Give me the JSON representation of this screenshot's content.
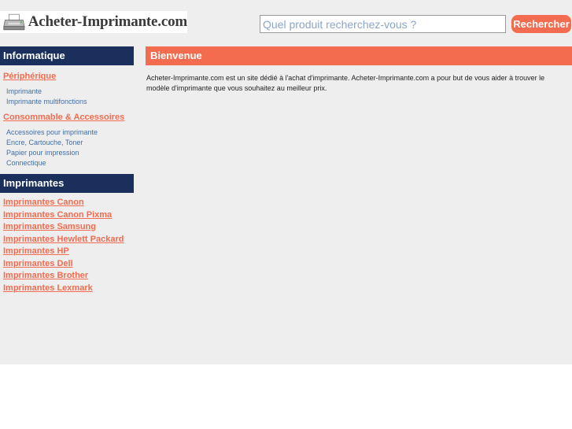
{
  "header": {
    "logo_text": "Acheter-Imprimante.com",
    "search": {
      "placeholder": "Quel produit recherchez-vous ?",
      "button_label": "Rechercher"
    }
  },
  "sidebar": {
    "informatique": {
      "title": "Informatique",
      "categories": [
        {
          "label": "Périphérique",
          "items": [
            "Imprimante",
            "Imprimante multifonctions"
          ]
        },
        {
          "label": "Consommable & Accessoires",
          "items": [
            "Accessoires pour imprimante",
            "Encre, Cartouche, Toner",
            "Papier pour impression",
            "Connectique"
          ]
        }
      ]
    },
    "imprimantes": {
      "title": "Imprimantes",
      "links": [
        "Imprimantes Canon",
        "Imprimantes Canon Pixma",
        "Imprimantes Samsung",
        "Imprimantes Hewlett Packard",
        "Imprimantes HP",
        "Imprimantes Dell",
        "Imprimantes Brother",
        "Imprimantes Lexmark"
      ]
    }
  },
  "main": {
    "title": "Bienvenue",
    "text": "Acheter-Imprimante.com est un site dédié à l'achat d'imprimante. Acheter-Imprimante.com a pour but de vous aider à trouver le modèle d'imprimante que vous souhaitez au meilleur prix."
  },
  "colors": {
    "accent": "#f36c4f",
    "navy": "#1a2f5c",
    "sublink": "#3f6ea8",
    "panel": "#eeeeee"
  },
  "icons": {
    "logo": "printer-icon"
  }
}
